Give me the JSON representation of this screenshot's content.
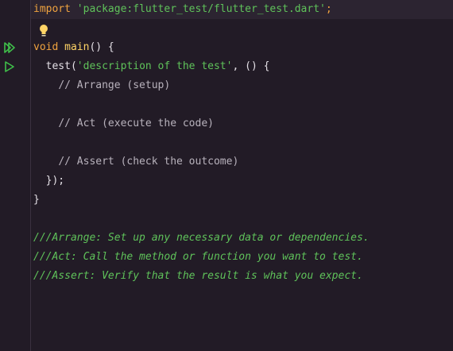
{
  "editor": {
    "lines": {
      "l1": {
        "kw": "import",
        "str": "'package:flutter_test/flutter_test.dart'",
        "end": ";"
      },
      "l3": {
        "kw": "void",
        "fn": "main",
        "rest": "() {"
      },
      "l4": {
        "fn": "test(",
        "str": "'description of the test'",
        "rest": ", () {"
      },
      "l5": {
        "cmt": "// Arrange (setup)"
      },
      "l7": {
        "cmt": "// Act (execute the code)"
      },
      "l9": {
        "cmt": "// Assert (check the outcome)"
      },
      "l10": {
        "txt": "});"
      },
      "l11": {
        "txt": "}"
      },
      "l13": {
        "doc": "///Arrange: Set up any necessary data or dependencies."
      },
      "l14": {
        "doc": "///Act: Call the method or function you want to test."
      },
      "l15": {
        "doc": "///Assert: Verify that the result is what you expect."
      }
    },
    "icons": {
      "run_all": "run-all-tests-icon",
      "run_test": "run-test-icon",
      "bulb": "lightbulb-icon"
    },
    "colors": {
      "background": "#221b26",
      "keyword": "#f0a33f",
      "string": "#5fc25a",
      "function": "#ffd466",
      "comment": "#b8b2bc",
      "run_icon": "#3fbf4a"
    }
  }
}
